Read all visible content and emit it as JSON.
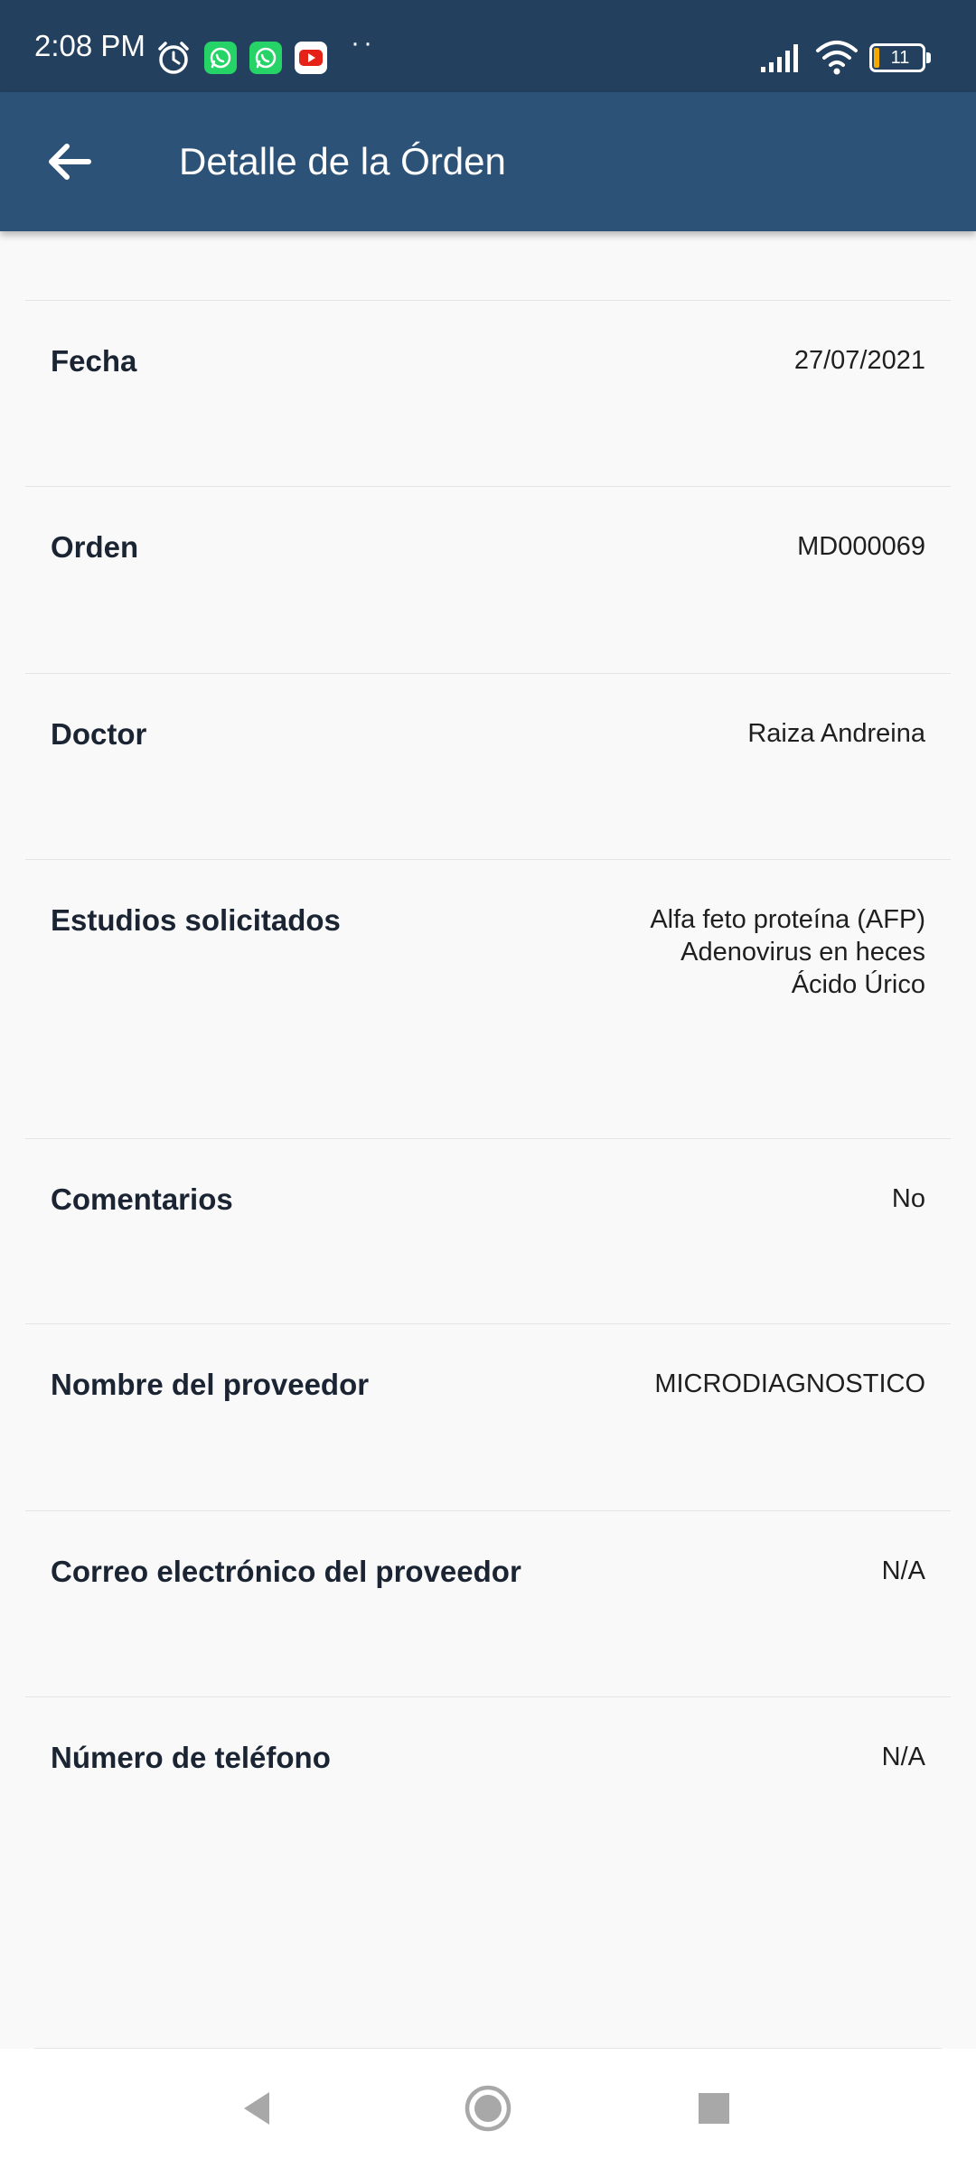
{
  "status_bar": {
    "time": "2:08 PM",
    "battery_level": "11",
    "icons": [
      "alarm-icon",
      "whatsapp-icon",
      "whatsapp-icon",
      "youtube-icon",
      "signal-icon",
      "wifi-icon",
      "battery-icon"
    ]
  },
  "header": {
    "title": "Detalle de la Órden"
  },
  "details": {
    "fecha_label": "Fecha",
    "fecha_value": "27/07/2021",
    "orden_label": "Orden",
    "orden_value": "MD000069",
    "doctor_label": "Doctor",
    "doctor_value": "Raiza Andreina",
    "estudios_label": "Estudios solicitados",
    "estudios_values": [
      "Alfa feto proteína (AFP)",
      "Adenovirus en heces",
      "Ácido Úrico"
    ],
    "comentarios_label": "Comentarios",
    "comentarios_value": "No",
    "proveedor_label": "Nombre del proveedor",
    "proveedor_value": "MICRODIAGNOSTICO",
    "correo_label": "Correo electrónico del proveedor",
    "correo_value": "N/A",
    "telefono_label": "Número de teléfono",
    "telefono_value": "N/A"
  },
  "colors": {
    "status_bar": "#23405f",
    "app_bar": "#2d5278",
    "background": "#f9f9f9",
    "whatsapp": "#25d366",
    "youtube": "#e62117"
  }
}
